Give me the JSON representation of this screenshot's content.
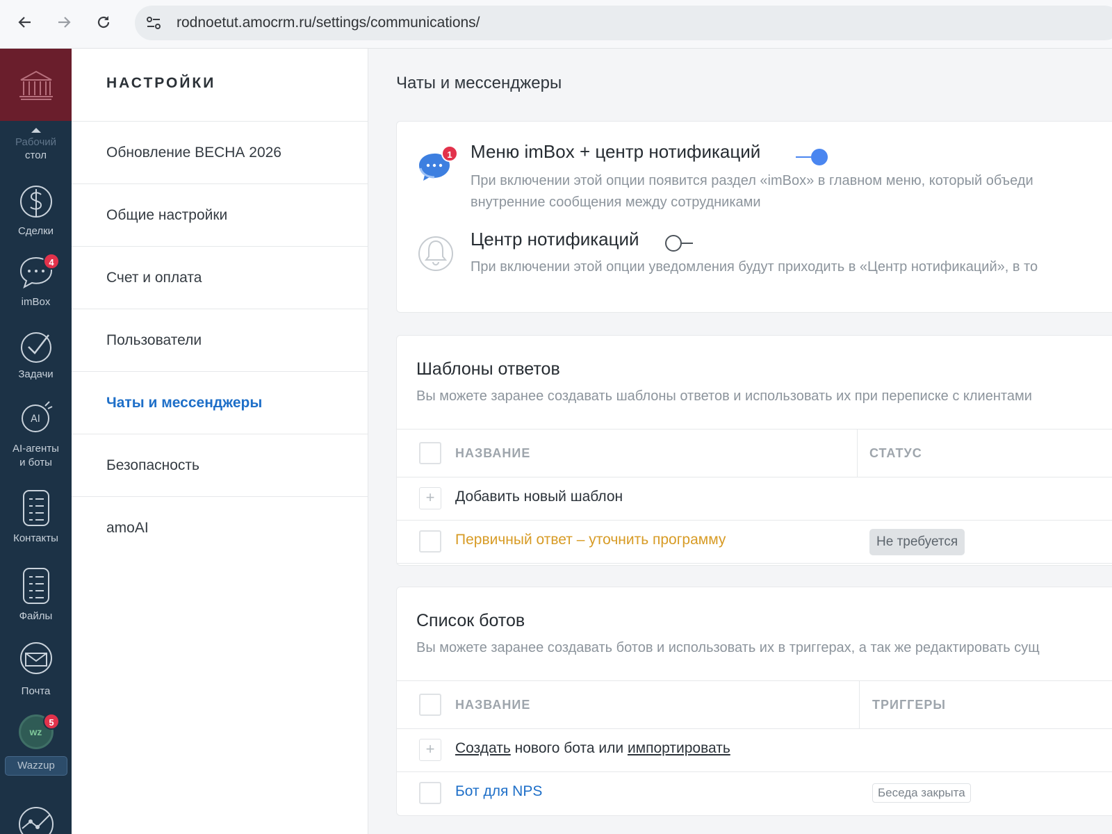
{
  "browser": {
    "url": "rodnoetut.amocrm.ru/settings/communications/",
    "back_icon": "arrow-left-icon",
    "forward_icon": "arrow-right-icon",
    "reload_icon": "reload-icon"
  },
  "left_nav": {
    "items": [
      {
        "label_1": "Рабочий",
        "label_2": "стол"
      },
      {
        "label": "Сделки"
      },
      {
        "label": "imBox",
        "badge": "4"
      },
      {
        "label": "Задачи"
      },
      {
        "label_1": "AI-агенты",
        "label_2": "и боты"
      },
      {
        "label": "Контакты"
      },
      {
        "label": "Файлы"
      },
      {
        "label": "Почта"
      },
      {
        "label": "Wazzup",
        "badge": "5",
        "avatar_text": "wz"
      }
    ]
  },
  "settings_menu": {
    "title": "НАСТРОЙКИ",
    "items": [
      {
        "label": "Обновление ВЕСНА 2026"
      },
      {
        "label": "Общие настройки"
      },
      {
        "label": "Счет и оплата"
      },
      {
        "label": "Пользователи"
      },
      {
        "label": "Чаты и мессенджеры",
        "active": true
      },
      {
        "label": "Безопасность"
      },
      {
        "label": "amoAI"
      }
    ]
  },
  "main": {
    "title": "Чаты и мессенджеры",
    "options": [
      {
        "title": "Меню imBox + центр нотификаций",
        "desc_1": "При включении этой опции появится раздел «imBox» в главном меню, который объеди",
        "desc_2": "внутренние сообщения между сотрудниками",
        "badge": "1",
        "enabled": true
      },
      {
        "title": "Центр нотификаций",
        "desc_1": "При включении этой опции уведомления будут приходить в «Центр нотификаций», в то",
        "enabled": false
      }
    ],
    "templates": {
      "title": "Шаблоны ответов",
      "desc": "Вы можете заранее создавать шаблоны ответов и использовать их при переписке с клиентами",
      "col_name": "НАЗВАНИЕ",
      "col_status": "СТАТУС",
      "add_label": "Добавить новый шаблон",
      "rows": [
        {
          "name": "Первичный ответ – уточнить программу",
          "status": "Не требуется"
        }
      ]
    },
    "bots": {
      "title": "Список ботов",
      "desc": "Вы можете заранее создавать ботов и использовать их в триггерах, а так же редактировать сущ",
      "col_name": "НАЗВАНИЕ",
      "col_triggers": "ТРИГГЕРЫ",
      "add_create": "Создать",
      "add_middle": " нового бота или ",
      "add_import": "импортировать",
      "rows": [
        {
          "name": "Бот для NPS",
          "trigger": "Беседа закрыта"
        }
      ]
    }
  },
  "colors": {
    "sidebar": "#1c3246",
    "logo_bg": "#6a1e2c",
    "accent": "#1e6fc8",
    "toggle_on": "#4a86f0",
    "template_link": "#d79b25",
    "badge": "#e2324b"
  }
}
